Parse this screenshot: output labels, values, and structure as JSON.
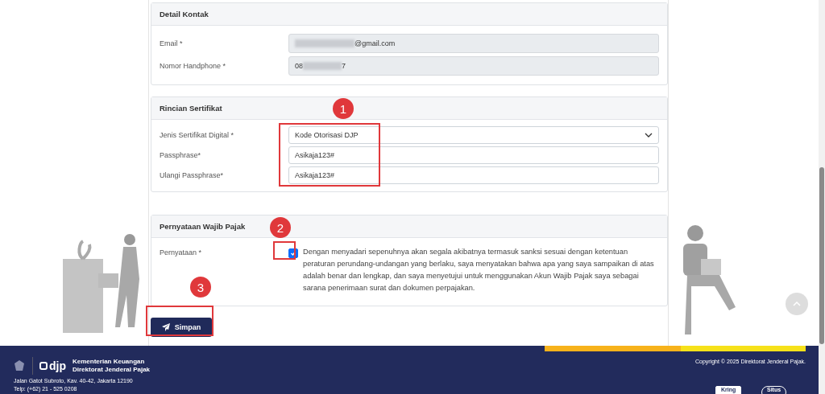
{
  "sections": [
    {
      "title": "Detail Kontak",
      "fields": [
        {
          "kind": "readonly",
          "label": "Email *",
          "value": [
            "@gmail.com"
          ]
        },
        {
          "kind": "readonly",
          "label": "Nomor Handphone *",
          "value": [
            "08",
            "7"
          ]
        }
      ]
    },
    {
      "title": "Rincian Sertifikat",
      "fields": [
        {
          "kind": "select",
          "label": "Jenis Sertifikat Digital *",
          "value": [
            "Kode Otorisasi DJP"
          ]
        },
        {
          "kind": "text",
          "label": "Passphrase*",
          "value": [
            "Asikaja123#"
          ]
        },
        {
          "kind": "text",
          "label": "Ulangi Passphrase*",
          "value": [
            "Asikaja123#"
          ]
        }
      ]
    },
    {
      "title": "Pernyataan Wajib Pajak",
      "fields": [
        {
          "kind": "checkbox",
          "label": "Pernyataan *",
          "checked": true,
          "text": "Dengan menyadari sepenuhnya akan segala akibatnya termasuk sanksi sesuai dengan ketentuan peraturan perundang-undangan yang berlaku, saya menyatakan bahwa apa yang saya sampaikan di atas adalah benar dan lengkap, dan saya menyetujui untuk menggunakan Akun Wajib Pajak saya sebagai sarana penerimaan surat dan dokumen perpajakan."
        }
      ]
    }
  ],
  "save_button": "Simpan",
  "annotations": [
    "1",
    "2",
    "3"
  ],
  "footer": {
    "logo_text": "djp",
    "org": [
      "Kementerian Keuangan",
      "Direktorat Jenderal Pajak"
    ],
    "address": "Jalan Gatot Subroto, Kav. 40-42, Jakarta 12190",
    "phone": "Telp: (+62) 21 - 525 0208",
    "copyright": "Copyright © 2025 Direktorat Jenderal Pajak.",
    "badges": [
      "Kring",
      "Situs"
    ]
  }
}
